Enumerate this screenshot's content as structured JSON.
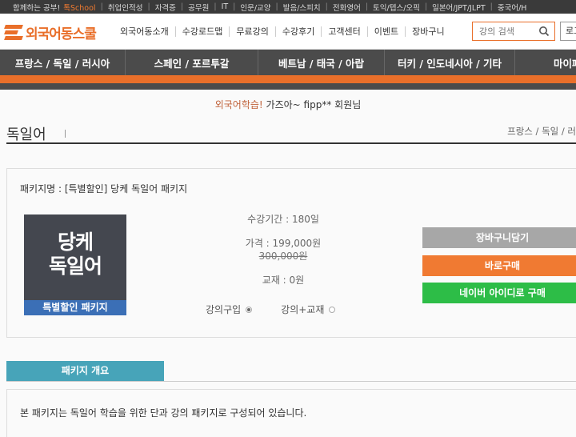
{
  "topbar": {
    "items": [
      "함께하는 공부!",
      "취업인적성",
      "자격증",
      "공무원",
      "IT",
      "인문/교양",
      "발음/스피치",
      "전화영어",
      "토익/텝스/오픽",
      "일본어/JPT/JLPT",
      "중국어/H"
    ],
    "brand": "School",
    "brand_prefix": "톡"
  },
  "header": {
    "logo_text": "외국어동스쿨",
    "gnb": [
      "외국어동소개",
      "수강로드맵",
      "무료강의",
      "수강후기",
      "고객센터",
      "이벤트",
      "장바구니"
    ],
    "search_placeholder": "강의 검색",
    "login_label": "로그"
  },
  "catnav": {
    "items": [
      "프랑스 / 독일 / 러시아",
      "스페인 / 포르투갈",
      "베트남 / 태국 / 아랍",
      "터키 / 인도네시아 / 기타",
      "마이페"
    ]
  },
  "greeting": {
    "study": "외국어학습!",
    "user": "가즈아~ fipp**",
    "suffix": "회원님"
  },
  "page": {
    "title": "독일어",
    "breadcrumb": "프랑스 / 독일 / 러"
  },
  "product": {
    "name": "패키지명 : [특별할인] 당케 독일어 패키지",
    "thumb_line1": "당케",
    "thumb_line2": "독일어",
    "thumb_badge": "특별할인 패키지",
    "period": "수강기간 : 180일",
    "price": "가격 : 199,000원",
    "old_price": "300,000원",
    "textbook": "교재 : 0원",
    "option_lecture": "강의구입",
    "option_lecture_book": "강의+교재",
    "btn_cart": "장바구니담기",
    "btn_buy": "바로구매",
    "btn_naver": "네이버 아이디로 구매"
  },
  "overview": {
    "tab_label": "패키지 개요",
    "description": "본 패키지는 독일어 학습을 위한 단과 강의 패키지로 구성되어 있습니다."
  },
  "colors": {
    "accent": "#e96f2a",
    "nav": "#4b4b4b",
    "naver": "#2dbd47",
    "tab": "#47a4b9",
    "badge": "#3b6fb6"
  }
}
